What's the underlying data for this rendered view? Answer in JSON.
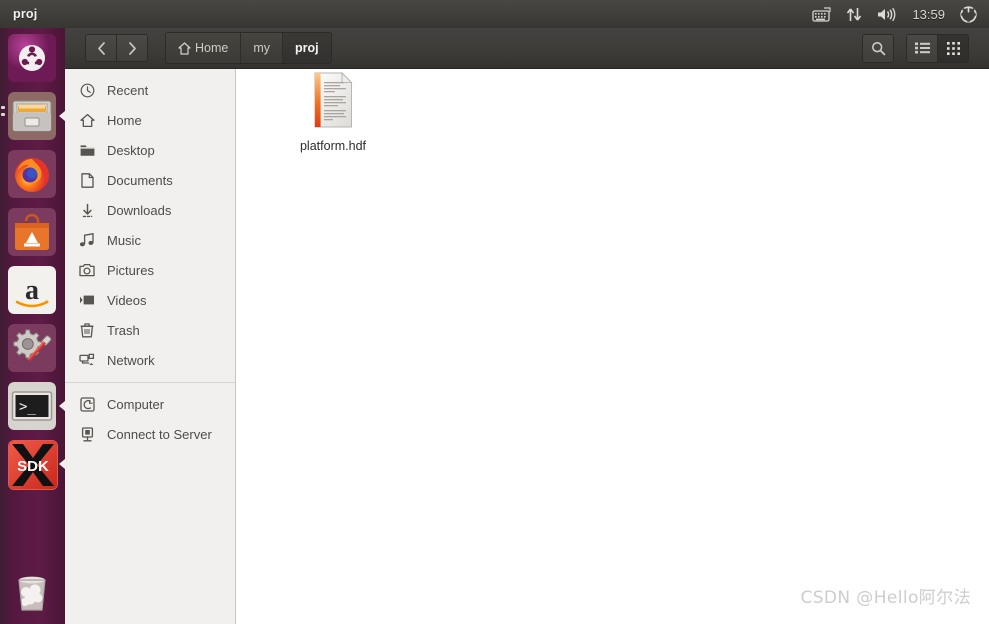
{
  "panel": {
    "title": "proj",
    "clock": "13:59",
    "tray": [
      {
        "name": "keyboard-indicator-icon",
        "label": "keyboard-icon"
      },
      {
        "name": "network-indicator-icon",
        "label": "network-up-down-icon"
      },
      {
        "name": "volume-indicator-icon",
        "label": "speaker-icon"
      },
      {
        "name": "system-menu-icon",
        "label": "gear-icon"
      }
    ]
  },
  "launcher": {
    "items": [
      {
        "name": "ubuntu-dash",
        "label": "Ubuntu Dash",
        "icon": "ubuntu-logo-icon",
        "running": false,
        "focused": false
      },
      {
        "name": "files",
        "label": "Files",
        "icon": "file-manager-icon",
        "running": true,
        "focused": true
      },
      {
        "name": "firefox",
        "label": "Firefox",
        "icon": "firefox-icon",
        "running": false,
        "focused": false
      },
      {
        "name": "ubuntu-software",
        "label": "Ubuntu Software",
        "icon": "software-bag-icon",
        "running": false,
        "focused": false
      },
      {
        "name": "amazon",
        "label": "Amazon",
        "icon": "amazon-icon",
        "running": false,
        "focused": false
      },
      {
        "name": "system-settings",
        "label": "System Settings",
        "icon": "gear-wrench-icon",
        "running": false,
        "focused": false
      },
      {
        "name": "terminal",
        "label": "Terminal",
        "icon": "terminal-icon",
        "running": true,
        "focused": false
      },
      {
        "name": "sdk",
        "label": "SDK",
        "icon": "sdk-x-icon",
        "running": true,
        "focused": false
      },
      {
        "name": "trash",
        "label": "Trash",
        "icon": "trash-icon",
        "running": false,
        "focused": false
      }
    ]
  },
  "toolbar": {
    "back_label": "‹",
    "forward_label": "›",
    "breadcrumb": [
      {
        "label": "Home",
        "icon": "home-icon",
        "active": false
      },
      {
        "label": "my",
        "icon": "",
        "active": false
      },
      {
        "label": "proj",
        "icon": "",
        "active": true
      }
    ],
    "search_label": "search-icon",
    "view_list_label": "list-view-icon",
    "view_grid_label": "grid-view-icon",
    "active_view": "grid"
  },
  "sidebar": {
    "items": [
      {
        "label": "Recent",
        "icon": "clock-icon"
      },
      {
        "label": "Home",
        "icon": "home-icon"
      },
      {
        "label": "Desktop",
        "icon": "folder-icon"
      },
      {
        "label": "Documents",
        "icon": "document-icon"
      },
      {
        "label": "Downloads",
        "icon": "download-arrow-icon"
      },
      {
        "label": "Music",
        "icon": "music-note-icon"
      },
      {
        "label": "Pictures",
        "icon": "camera-icon"
      },
      {
        "label": "Videos",
        "icon": "video-icon"
      },
      {
        "label": "Trash",
        "icon": "trash-icon"
      },
      {
        "label": "Network",
        "icon": "network-icon"
      }
    ],
    "items2": [
      {
        "label": "Computer",
        "icon": "computer-disk-icon"
      },
      {
        "label": "Connect to Server",
        "icon": "server-connect-icon"
      }
    ]
  },
  "content": {
    "files": [
      {
        "name": "platform.hdf",
        "icon": "hdf-document-icon"
      }
    ]
  },
  "watermark": "CSDN @Hello阿尔法",
  "colors": {
    "panel_bg": "#403f3b",
    "launcher_bg": "#5e1b46",
    "header_bg": "#3d3c39",
    "sidebar_bg": "#f1f0ee",
    "content_bg": "#ffffff",
    "accent_orange": "#e8632a",
    "clock_text": "#d8d4cf"
  }
}
